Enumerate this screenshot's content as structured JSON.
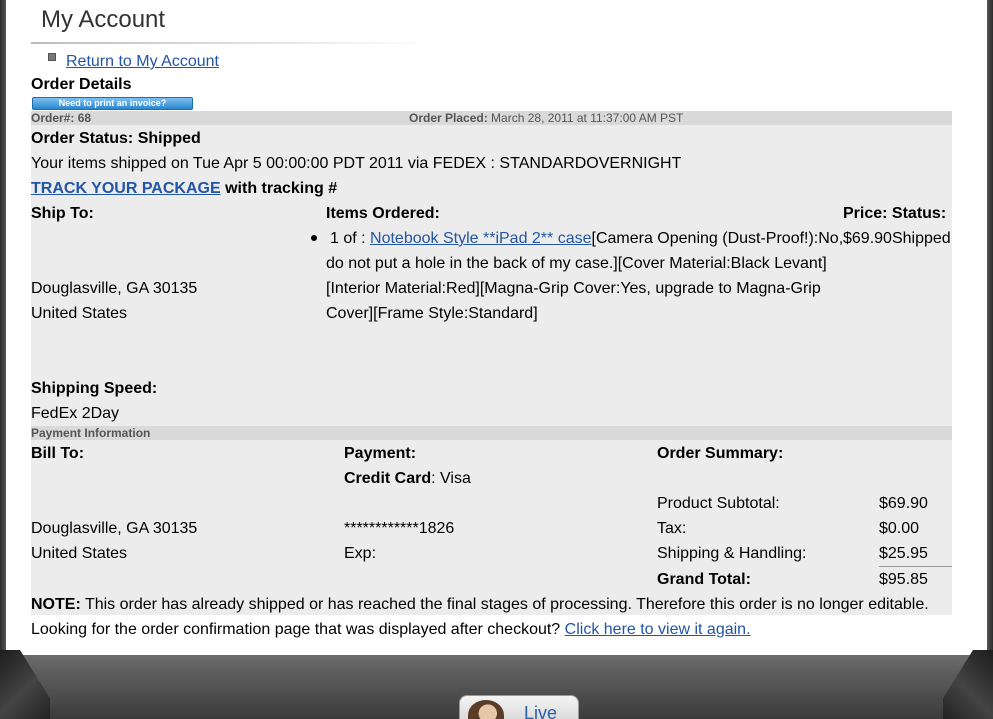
{
  "page": {
    "title": "My Account"
  },
  "nav": {
    "return_link": "Return to My Account"
  },
  "order": {
    "heading": "Order Details",
    "invoice_button": "Need to print an invoice?",
    "number_label": "Order#:",
    "number": "68",
    "placed_label": "Order Placed:",
    "placed_value": "March 28, 2011 at 11:37:00 AM PST",
    "status_text": "Order Status: Shipped",
    "shipped_text": "Your items shipped on Tue Apr 5 00:00:00 PDT 2011 via FEDEX : STANDARDOVERNIGHT",
    "track_link": "TRACK YOUR PACKAGE",
    "tracking_text": "with tracking #"
  },
  "shipping": {
    "ship_to_label": "Ship To:",
    "city_line": "Douglasville, GA 30135",
    "country": "United States",
    "speed_label": "Shipping Speed:",
    "speed_value": "FedEx 2Day"
  },
  "items": {
    "header": "Items Ordered:",
    "price_status_header": "Price: Status:",
    "list": [
      {
        "qty_prefix": "1 of :",
        "name": "Notebook Style **iPad 2** case",
        "options_line1": "[Camera Opening (Dust-Proof!):No,",
        "options_line2": "do not put a hole in the back of my case.][Cover Material:Black Levant]",
        "options_line3": "[Interior Material:Red][Magna-Grip Cover:Yes, upgrade to Magna-Grip",
        "options_line4": "Cover][Frame Style:Standard]",
        "price_status": "$69.90Shipped"
      }
    ]
  },
  "payment_info": {
    "section_label": "Payment Information",
    "bill_to_label": "Bill To:",
    "city_line": "Douglasville, GA 30135",
    "country": "United States",
    "payment_label": "Payment:",
    "card_label": "Credit Card",
    "card_type": ": Visa",
    "card_number": "************1826",
    "exp_label": "Exp:"
  },
  "summary": {
    "header": "Order Summary:",
    "rows": [
      {
        "label": "Product Subtotal:",
        "value": "$69.90"
      },
      {
        "label": "Tax:",
        "value": "$0.00"
      },
      {
        "label": "Shipping & Handling:",
        "value": "$25.95"
      }
    ],
    "grand_label": "Grand Total:",
    "grand_value": "$95.85"
  },
  "notes": {
    "note_label": "NOTE:",
    "note_text": "This order has already shipped or has reached the final stages of processing. Therefore this order is no longer editable.",
    "confirm_text": "Looking for the order confirmation page that was displayed after checkout?",
    "confirm_link": "Click here to view it again."
  },
  "chat": {
    "live_label": "Live"
  }
}
